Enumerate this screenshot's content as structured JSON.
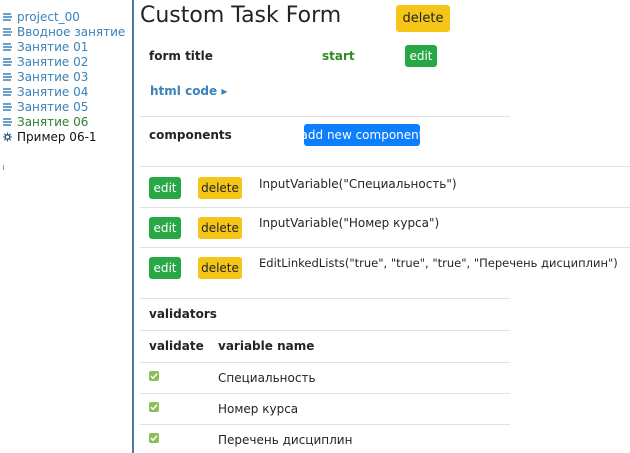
{
  "sidebar": {
    "items": [
      {
        "label": "project_00",
        "state": "normal"
      },
      {
        "label": "Вводное занятие",
        "state": "normal"
      },
      {
        "label": "Занятие 01",
        "state": "normal"
      },
      {
        "label": "Занятие 02",
        "state": "normal"
      },
      {
        "label": "Занятие 03",
        "state": "normal"
      },
      {
        "label": "Занятие 04",
        "state": "normal"
      },
      {
        "label": "Занятие 05",
        "state": "normal"
      },
      {
        "label": "Занятие 06",
        "state": "active"
      },
      {
        "label": "Пример 06-1",
        "state": "child"
      }
    ]
  },
  "header": {
    "title": "Custom Task Form",
    "delete_label": "delete"
  },
  "form_title": {
    "label": "form title",
    "value": "start",
    "edit_label": "edit"
  },
  "html_code": {
    "label": "html code ▸"
  },
  "components": {
    "label": "components",
    "add_label": "add new component",
    "items": [
      {
        "text": "InputVariable(\"Специальность\")",
        "edit_label": "edit",
        "delete_label": "delete"
      },
      {
        "text": "InputVariable(\"Номер курса\")",
        "edit_label": "edit",
        "delete_label": "delete"
      },
      {
        "text": "EditLinkedLists(\"true\", \"true\", \"true\", \"Перечень дисциплин\")",
        "edit_label": "edit",
        "delete_label": "delete"
      }
    ]
  },
  "validators": {
    "label": "validators",
    "columns": [
      "validate",
      "variable name"
    ],
    "rows": [
      {
        "checked": true,
        "name": "Специальность"
      },
      {
        "checked": true,
        "name": "Номер курса"
      },
      {
        "checked": true,
        "name": "Перечень дисциплин"
      }
    ]
  },
  "colors": {
    "link": "#3a82b8",
    "active": "#2e7d32",
    "success": "#28a745",
    "warning": "#f5c518",
    "primary": "#0d7efc",
    "divider": "#4a7aa6"
  }
}
